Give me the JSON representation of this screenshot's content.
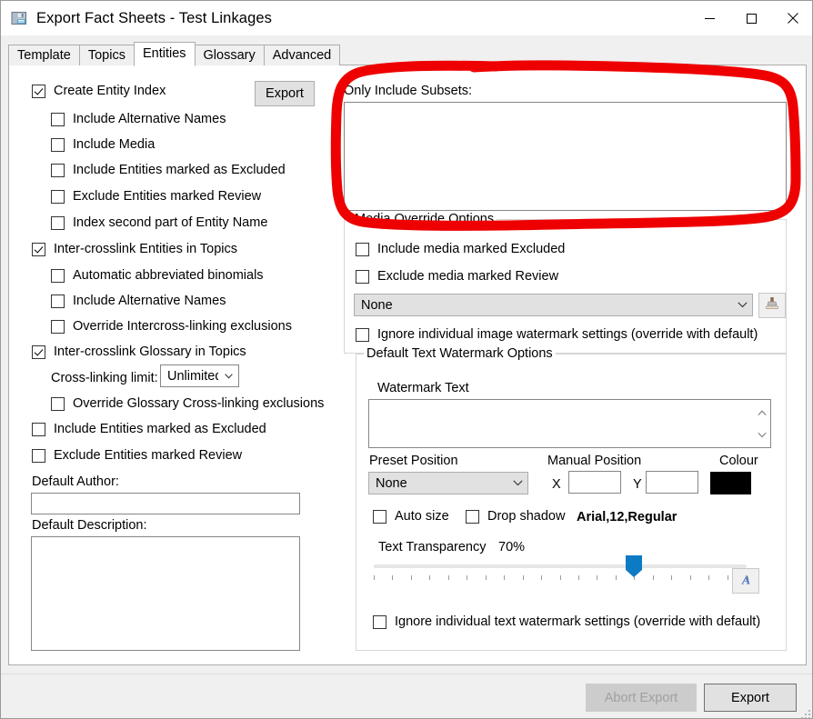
{
  "window": {
    "title": "Export Fact Sheets - Test Linkages",
    "icon": "save-disk-icon",
    "minimize": "minimize-icon",
    "maximize": "maximize-icon",
    "close": "close-icon"
  },
  "tabs": [
    {
      "label": "Template",
      "active": false
    },
    {
      "label": "Topics",
      "active": false
    },
    {
      "label": "Entities",
      "active": true
    },
    {
      "label": "Glossary",
      "active": false
    },
    {
      "label": "Advanced",
      "active": false
    }
  ],
  "left_panel": {
    "export_button": "Export",
    "options": [
      {
        "label": "Create Entity Index",
        "checked": true,
        "indent": 0
      },
      {
        "label": "Include Alternative Names",
        "checked": false,
        "indent": 1
      },
      {
        "label": "Include Media",
        "checked": false,
        "indent": 1
      },
      {
        "label": "Include Entities marked as Excluded",
        "checked": false,
        "indent": 1
      },
      {
        "label": "Exclude Entities marked Review",
        "checked": false,
        "indent": 1
      },
      {
        "label": "Index second part of Entity Name",
        "checked": false,
        "indent": 1
      },
      {
        "label": "Inter-crosslink Entities in Topics",
        "checked": true,
        "indent": 0
      },
      {
        "label": "Automatic abbreviated binomials",
        "checked": false,
        "indent": 1
      },
      {
        "label": "Include Alternative Names",
        "checked": false,
        "indent": 1
      },
      {
        "label": "Override Intercross-linking exclusions",
        "checked": false,
        "indent": 1
      },
      {
        "label": "Inter-crosslink Glossary in Topics",
        "checked": true,
        "indent": 0
      }
    ],
    "crosslink_limit_label": "Cross-linking limit:",
    "crosslink_limit_value": "Unlimited",
    "options_after": [
      {
        "label": "Override Glossary Cross-linking exclusions",
        "checked": false,
        "indent": 1
      },
      {
        "label": "Include Entities marked as Excluded",
        "checked": false,
        "indent": 0
      },
      {
        "label": "Exclude Entities marked Review",
        "checked": false,
        "indent": 0
      }
    ],
    "default_author_label": "Default Author:",
    "default_author_value": "",
    "default_description_label": "Default Description:",
    "default_description_value": ""
  },
  "right_panel": {
    "subsets_label": "Only Include Subsets:",
    "subsets_items": [],
    "media_group_title": "Media Override Options",
    "media_options": [
      {
        "label": "Include media marked Excluded",
        "checked": false
      },
      {
        "label": "Exclude media marked Review",
        "checked": false
      }
    ],
    "image_watermark_value": "None",
    "stamp_button_icon": "stamp-icon",
    "ignore_image_watermark": "Ignore individual image watermark settings (override with default)",
    "text_watermark_group_title": "Default Text Watermark Options",
    "watermark_text_label": "Watermark Text",
    "watermark_text_value": "",
    "preset_position_label": "Preset Position",
    "preset_position_value": "None",
    "manual_position_label": "Manual Position",
    "manual_x_label": "X",
    "manual_x_value": "",
    "manual_y_label": "Y",
    "manual_y_value": "",
    "colour_label": "Colour",
    "colour_value": "#000000",
    "auto_size_label": "Auto size",
    "auto_size_checked": false,
    "drop_shadow_label": "Drop shadow",
    "drop_shadow_checked": false,
    "font_summary": "Arial,12,Regular",
    "font_button_icon": "font-a-icon",
    "transparency_label": "Text Transparency",
    "transparency_value": "70%",
    "transparency_percent": 70,
    "ignore_text_watermark": "Ignore individual text watermark settings (override with default)"
  },
  "footer": {
    "abort_label": "Abort Export",
    "abort_disabled": true,
    "export_label": "Export"
  },
  "annotation": {
    "type": "hand-drawn-oval",
    "colour": "#ee0000",
    "target": "Only Include Subsets list box"
  }
}
